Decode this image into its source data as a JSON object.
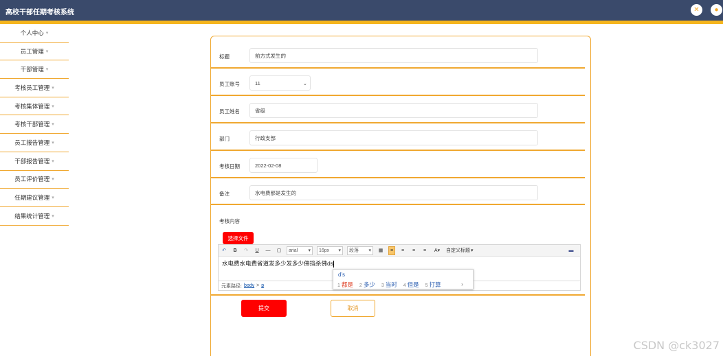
{
  "app": {
    "title": "高校干部任期考核系统"
  },
  "header_icons": [
    "tools-icon",
    "user-icon"
  ],
  "sidebar": {
    "items": [
      {
        "label": "个人中心"
      },
      {
        "label": "员工管理"
      },
      {
        "label": "干部管理"
      },
      {
        "label": "考核员工管理"
      },
      {
        "label": "考核集体管理"
      },
      {
        "label": "考核干部管理"
      },
      {
        "label": "员工报告管理"
      },
      {
        "label": "干部报告管理"
      },
      {
        "label": "员工评价管理"
      },
      {
        "label": "任期建议管理"
      },
      {
        "label": "结果统计管理"
      }
    ]
  },
  "form": {
    "title": {
      "label": "标题",
      "value": "前方式发生的"
    },
    "employee_no": {
      "label": "员工账号",
      "value": "11"
    },
    "employee_name": {
      "label": "员工姓名",
      "value": "省级"
    },
    "department": {
      "label": "部门",
      "value": "行政支部"
    },
    "date": {
      "label": "考核日期",
      "value": "2022-02-08"
    },
    "remark": {
      "label": "备注",
      "value": "水电费那是发生的"
    },
    "content": {
      "label": "考核内容"
    },
    "choose_file": "选择文件",
    "submit": "提交",
    "cancel": "取消"
  },
  "editor": {
    "font_name": "arial",
    "font_size": "16px",
    "paragraph": "段落",
    "custom_title": "自定义标题",
    "text": "水电费水电费省道发多少发多少佛挡杀佛ds",
    "path_label": "元素路径:",
    "path_body": "body",
    "path_sep": ">",
    "path_p": "p"
  },
  "ime": {
    "input": "d's",
    "candidates": [
      {
        "n": "1",
        "text": "都是"
      },
      {
        "n": "2",
        "text": "多少"
      },
      {
        "n": "3",
        "text": "当时"
      },
      {
        "n": "4",
        "text": "但是"
      },
      {
        "n": "5",
        "text": "打算"
      }
    ],
    "next": "›"
  },
  "watermark": "CSDN @ck3027",
  "colors": {
    "topbar": "#3a4a6b",
    "accent": "#f5b51e",
    "border": "#f0a830",
    "primary_button": "#ff0000"
  }
}
